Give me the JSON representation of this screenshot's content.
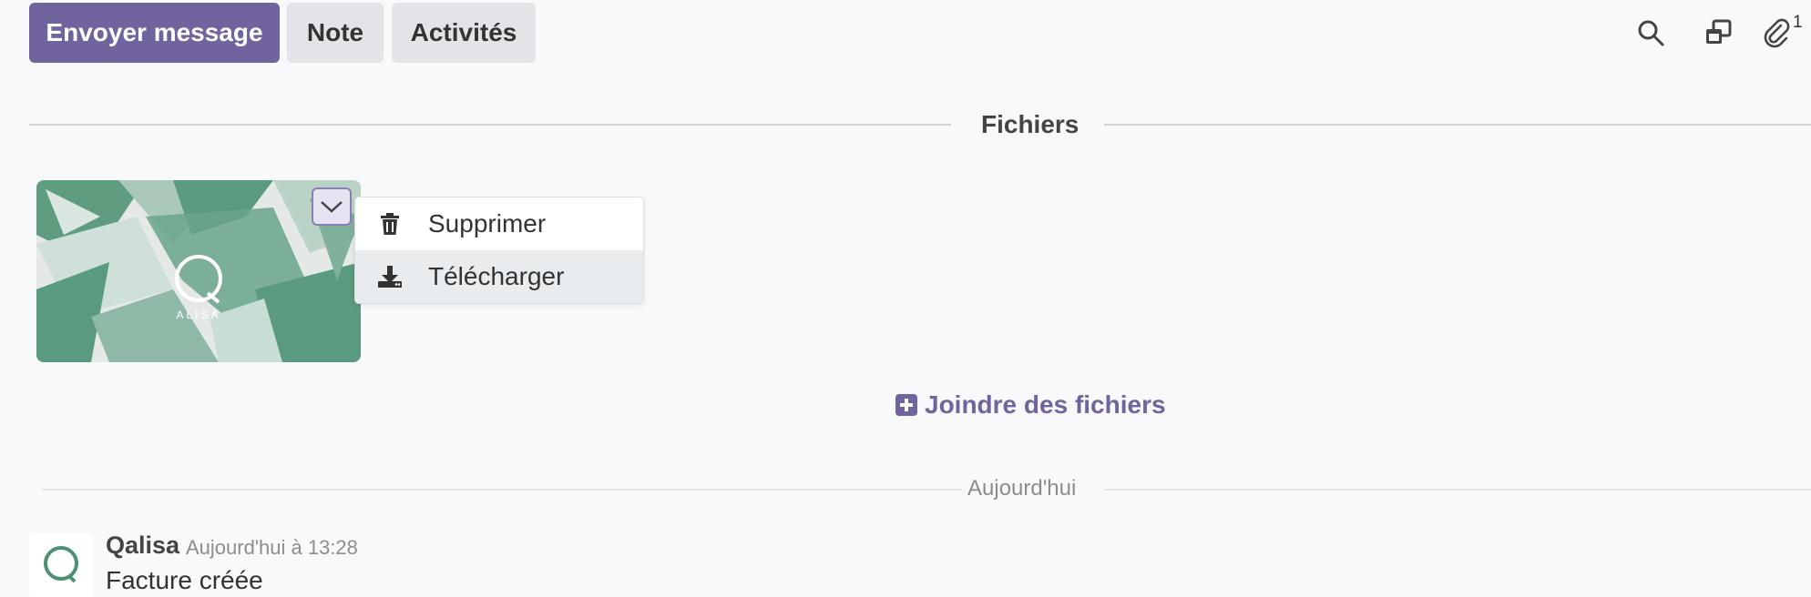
{
  "composer": {
    "send_message": "Envoyer message",
    "note": "Note",
    "activities": "Activités"
  },
  "top_icons": {
    "search": "search-icon",
    "windows": "window-icon",
    "attachment": "paperclip-icon",
    "attachment_count": "1"
  },
  "files_section": {
    "title": "Fichiers",
    "attachment_menu": {
      "items": [
        {
          "label": "Supprimer",
          "icon": "trash-icon"
        },
        {
          "label": "Télécharger",
          "icon": "download-icon"
        }
      ]
    },
    "thumbnail_logo_text": "ALISA",
    "attach_files": "Joindre des fichiers"
  },
  "chatter": {
    "day_separator": "Aujourd'hui",
    "message": {
      "author": "Qalisa",
      "date": "Aujourd'hui à 13:28",
      "body": "Facture créée"
    }
  },
  "colors": {
    "primary": "#71639e",
    "background": "#f8f9fb",
    "thumbnail_green": "#5a9a7e"
  }
}
